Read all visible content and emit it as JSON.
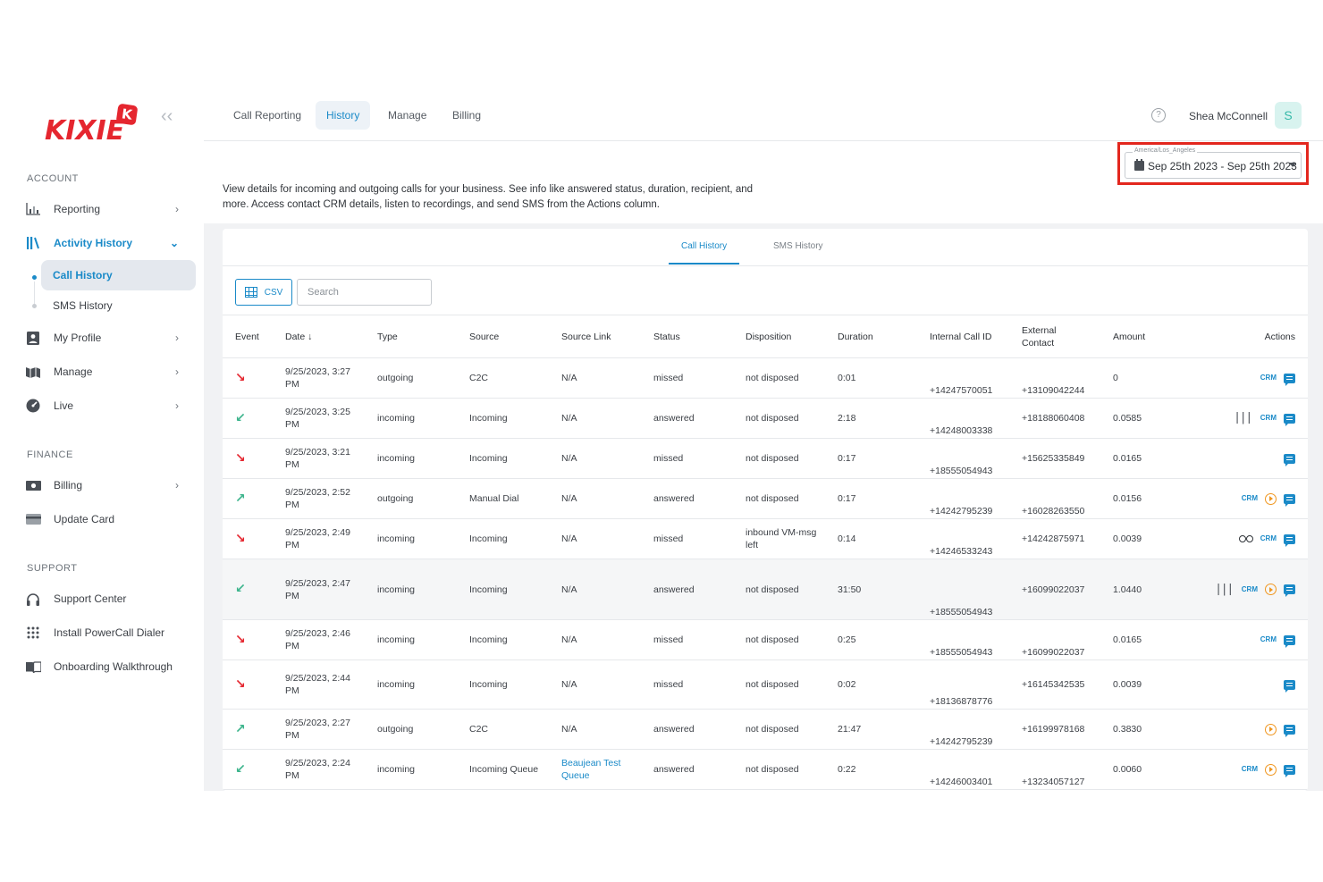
{
  "brand": {
    "logo_text": "KIXIE",
    "logo_badge": "K",
    "accent": "#1a8ac8",
    "brand_red": "#e5262f"
  },
  "sidebar": {
    "sections": {
      "account": "ACCOUNT",
      "finance": "FINANCE",
      "support": "SUPPORT"
    },
    "reporting": "Reporting",
    "activity_history": "Activity History",
    "call_history": "Call History",
    "sms_history": "SMS History",
    "my_profile": "My Profile",
    "manage": "Manage",
    "live": "Live",
    "billing": "Billing",
    "update_card": "Update Card",
    "support_center": "Support Center",
    "install_dialer": "Install PowerCall Dialer",
    "onboarding": "Onboarding Walkthrough"
  },
  "topbar": {
    "tabs": [
      "Call Reporting",
      "History",
      "Manage",
      "Billing"
    ],
    "active_tab": "History",
    "help": "?",
    "user_name": "Shea McConnell",
    "avatar_initial": "S"
  },
  "date_filter": {
    "timezone": "America/Los_Angeles",
    "range": "Sep 25th 2023 - Sep 25th 2023"
  },
  "description": "View details for incoming and outgoing calls for your business. See info like answered status, duration, recipient, and more. Access contact CRM details, listen to recordings, and send SMS from the Actions column.",
  "card_tabs": {
    "call_history": "Call History",
    "sms_history": "SMS History"
  },
  "toolbar": {
    "csv_label": "CSV",
    "search_placeholder": "Search"
  },
  "table": {
    "headers": [
      "Event",
      "Date ↓",
      "Type",
      "Source",
      "Source Link",
      "Status",
      "Disposition",
      "Duration",
      "Internal Call ID",
      "External Contact",
      "Amount",
      "Actions"
    ],
    "rows": [
      {
        "event": "missed",
        "date": "9/25/2023, 3:27 PM",
        "type": "outgoing",
        "source": "C2C",
        "source_link": "N/A",
        "status": "missed",
        "disposition": "not disposed",
        "duration": "0:01",
        "internal": "+14247570051",
        "external": "+13109042244",
        "amount": "0",
        "actions": [
          "crm",
          "sms"
        ]
      },
      {
        "event": "incoming",
        "date": "9/25/2023, 3:25 PM",
        "type": "incoming",
        "source": "Incoming",
        "source_link": "N/A",
        "status": "answered",
        "disposition": "not disposed",
        "duration": "2:18",
        "internal": "+14248003338",
        "external": "+18188060408",
        "amount": "0.0585",
        "actions": [
          "wave",
          "crm",
          "sms"
        ]
      },
      {
        "event": "missed",
        "date": "9/25/2023, 3:21 PM",
        "type": "incoming",
        "source": "Incoming",
        "source_link": "N/A",
        "status": "missed",
        "disposition": "not disposed",
        "duration": "0:17",
        "internal": "+18555054943",
        "external": "+15625335849",
        "amount": "0.0165",
        "actions": [
          "sms"
        ]
      },
      {
        "event": "outgoing",
        "date": "9/25/2023, 2:52 PM",
        "type": "outgoing",
        "source": "Manual Dial",
        "source_link": "N/A",
        "status": "answered",
        "disposition": "not disposed",
        "duration": "0:17",
        "internal": "+14242795239",
        "external": "+16028263550",
        "amount": "0.0156",
        "actions": [
          "crm",
          "play",
          "sms"
        ]
      },
      {
        "event": "missed",
        "date": "9/25/2023, 2:49 PM",
        "type": "incoming",
        "source": "Incoming",
        "source_link": "N/A",
        "status": "missed",
        "disposition": "inbound VM-msg left",
        "duration": "0:14",
        "internal": "+14246533243",
        "external": "+14242875971",
        "amount": "0.0039",
        "actions": [
          "vm",
          "crm",
          "sms"
        ]
      },
      {
        "event": "incoming",
        "date": "9/25/2023, 2:47 PM",
        "type": "incoming",
        "source": "Incoming",
        "source_link": "N/A",
        "status": "answered",
        "disposition": "not disposed",
        "duration": "31:50",
        "internal": "+18555054943",
        "external": "+16099022037",
        "amount": "1.0440",
        "actions": [
          "wave",
          "crm",
          "play",
          "sms"
        ]
      },
      {
        "event": "missed",
        "date": "9/25/2023, 2:46 PM",
        "type": "incoming",
        "source": "Incoming",
        "source_link": "N/A",
        "status": "missed",
        "disposition": "not disposed",
        "duration": "0:25",
        "internal": "+18555054943",
        "external": "+16099022037",
        "amount": "0.0165",
        "actions": [
          "crm",
          "sms"
        ]
      },
      {
        "event": "missed",
        "date": "9/25/2023, 2:44 PM",
        "type": "incoming",
        "source": "Incoming",
        "source_link": "N/A",
        "status": "missed",
        "disposition": "not disposed",
        "duration": "0:02",
        "internal": "+18136878776",
        "external": "+16145342535",
        "amount": "0.0039",
        "actions": [
          "sms"
        ]
      },
      {
        "event": "outgoing",
        "date": "9/25/2023, 2:27 PM",
        "type": "outgoing",
        "source": "C2C",
        "source_link": "N/A",
        "status": "answered",
        "disposition": "not disposed",
        "duration": "21:47",
        "internal": "+14242795239",
        "external": "+16199978168",
        "amount": "0.3830",
        "actions": [
          "play",
          "sms"
        ]
      },
      {
        "event": "incoming",
        "date": "9/25/2023, 2:24 PM",
        "type": "incoming",
        "source": "Incoming Queue",
        "source_link": "Beaujean Test Queue",
        "status": "answered",
        "disposition": "not disposed",
        "duration": "0:22",
        "internal": "+14246003401",
        "external": "+13234057127",
        "amount": "0.0060",
        "actions": [
          "crm",
          "play",
          "sms"
        ]
      }
    ],
    "highlighted_row": 5
  },
  "icons": {
    "missed": "↘",
    "incoming": "↙",
    "outgoing": "↗",
    "crm": "CRM"
  }
}
